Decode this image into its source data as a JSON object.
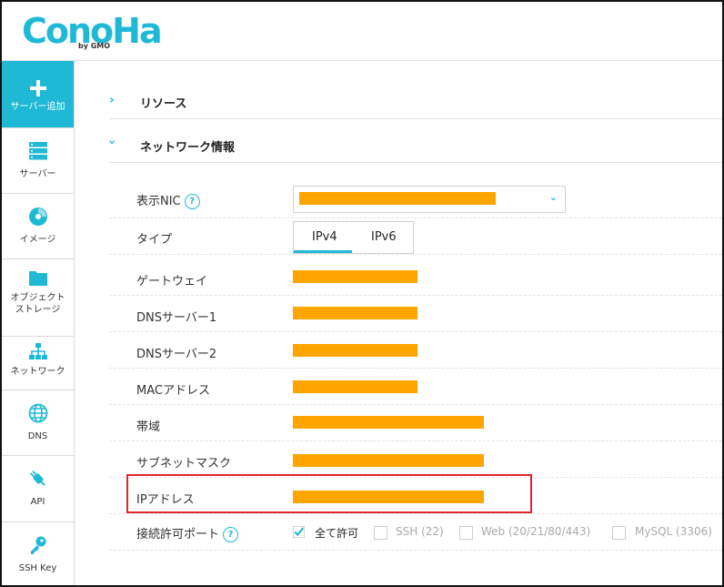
{
  "brand": {
    "logo": "ConoHa",
    "sublogo": "by GMO"
  },
  "sidebar": {
    "items": [
      {
        "label": "サーバー追加",
        "icon": "plus-icon"
      },
      {
        "label": "サーバー",
        "icon": "server-icon"
      },
      {
        "label": "イメージ",
        "icon": "disc-icon"
      },
      {
        "label": "オブジェクト\nストレージ",
        "label1": "オブジェクト",
        "label2": "ストレージ",
        "icon": "folder-icon"
      },
      {
        "label": "ネットワーク",
        "icon": "network-icon"
      },
      {
        "label": "DNS",
        "icon": "globe-icon"
      },
      {
        "label": "API",
        "icon": "plug-icon"
      },
      {
        "label": "SSH Key",
        "icon": "key-icon"
      }
    ]
  },
  "sections": {
    "resources": {
      "title": "リソース",
      "expanded": false
    },
    "network_info": {
      "title": "ネットワーク情報",
      "expanded": true
    }
  },
  "network": {
    "display_nic_label": "表示NIC",
    "type_label": "タイプ",
    "type_tabs": [
      "IPv4",
      "IPv6"
    ],
    "type_selected": "IPv4",
    "gateway_label": "ゲートウェイ",
    "dns1_label": "DNSサーバー1",
    "dns2_label": "DNSサーバー2",
    "mac_label": "MACアドレス",
    "bandwidth_label": "帯域",
    "subnet_label": "サブネットマスク",
    "ip_label": "IPアドレス",
    "ports_label": "接続許可ポート",
    "ports": [
      {
        "label": "全て許可",
        "checked": true
      },
      {
        "label": "SSH (22)",
        "checked": false
      },
      {
        "label": "Web (20/21/80/443)",
        "checked": false
      },
      {
        "label": "MySQL (3306)",
        "checked": false
      }
    ]
  },
  "colors": {
    "accent": "#1fb9d6",
    "redacted": "#ffa500",
    "highlight": "#e0262b"
  }
}
